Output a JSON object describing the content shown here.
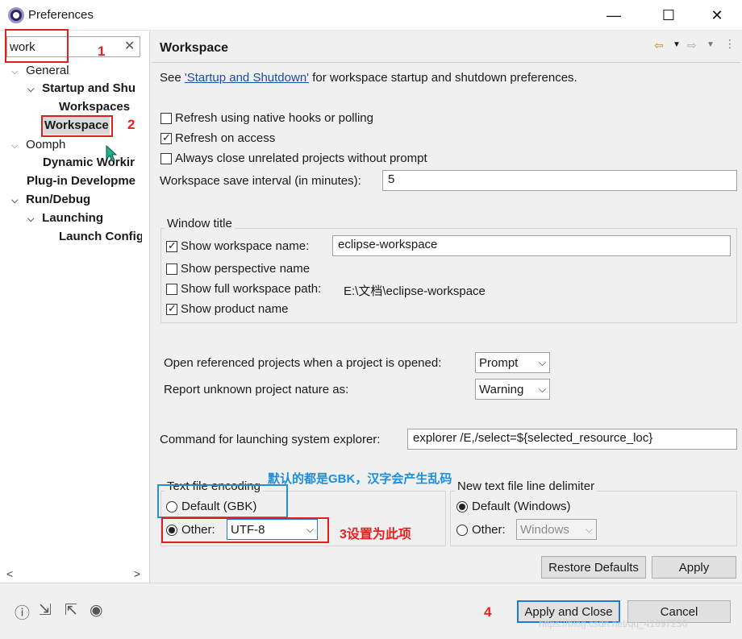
{
  "window": {
    "title": "Preferences",
    "minimize": "—",
    "maximize": "☐",
    "close": "✕"
  },
  "filter": {
    "value": "work",
    "clear": "✕"
  },
  "tree": {
    "items": [
      {
        "label": "General",
        "twisty": "⌵"
      },
      {
        "label": "Startup and Shu",
        "twisty": "⌵"
      },
      {
        "label": "Workspaces"
      },
      {
        "label": "Workspace"
      },
      {
        "label": "Oomph",
        "twisty": "⌵"
      },
      {
        "label": "Dynamic Workir"
      },
      {
        "label": "Plug-in Developme"
      },
      {
        "label": "Run/Debug",
        "twisty": "⌵"
      },
      {
        "label": "Launching",
        "twisty": "⌵"
      },
      {
        "label": "Launch Config"
      }
    ],
    "scroll_left": "<",
    "scroll_right": ">"
  },
  "annotations": {
    "n1": "1",
    "n2": "2",
    "n3": "3设置为此项",
    "n4": "4",
    "blue_note": "默认的都是GBK，汉字会产生乱码"
  },
  "page": {
    "title": "Workspace",
    "intro_prefix": "See ",
    "intro_link": "'Startup and Shutdown'",
    "intro_suffix": " for workspace startup and shutdown preferences.",
    "refresh_native": "Refresh using native hooks or polling",
    "refresh_access": "Refresh on access",
    "always_close": "Always close unrelated projects without prompt",
    "save_interval_label": "Workspace save interval (in minutes):",
    "save_interval_value": "5",
    "window_title_group": "Window title",
    "show_ws_name": "Show workspace name:",
    "ws_name_value": "eclipse-workspace",
    "show_perspective": "Show perspective name",
    "show_full_path": "Show full workspace path:",
    "full_path_value": "E:\\文档\\eclipse-workspace",
    "show_product": "Show product name",
    "open_ref_label": "Open referenced projects when a project is opened:",
    "open_ref_value": "Prompt",
    "report_unknown_label": "Report unknown project nature as:",
    "report_unknown_value": "Warning",
    "explorer_label": "Command for launching system explorer:",
    "explorer_value": "explorer /E,/select=${selected_resource_loc}",
    "encoding_group": "Text file encoding",
    "encoding_default": "Default (GBK)",
    "encoding_other": "Other:",
    "encoding_other_value": "UTF-8",
    "delimiter_group": "New text file line delimiter",
    "delimiter_default": "Default (Windows)",
    "delimiter_other": "Other:",
    "delimiter_other_value": "Windows",
    "restore_defaults": "Restore Defaults",
    "apply": "Apply"
  },
  "footer": {
    "apply_close": "Apply and Close",
    "cancel": "Cancel",
    "watermark": "https://blog.csdn.net/qq_41697230"
  },
  "icons": [
    "eclipse-app-icon",
    "help-icon",
    "import-icon",
    "export-icon",
    "record-icon",
    "back-icon",
    "forward-icon",
    "menu-icon"
  ]
}
